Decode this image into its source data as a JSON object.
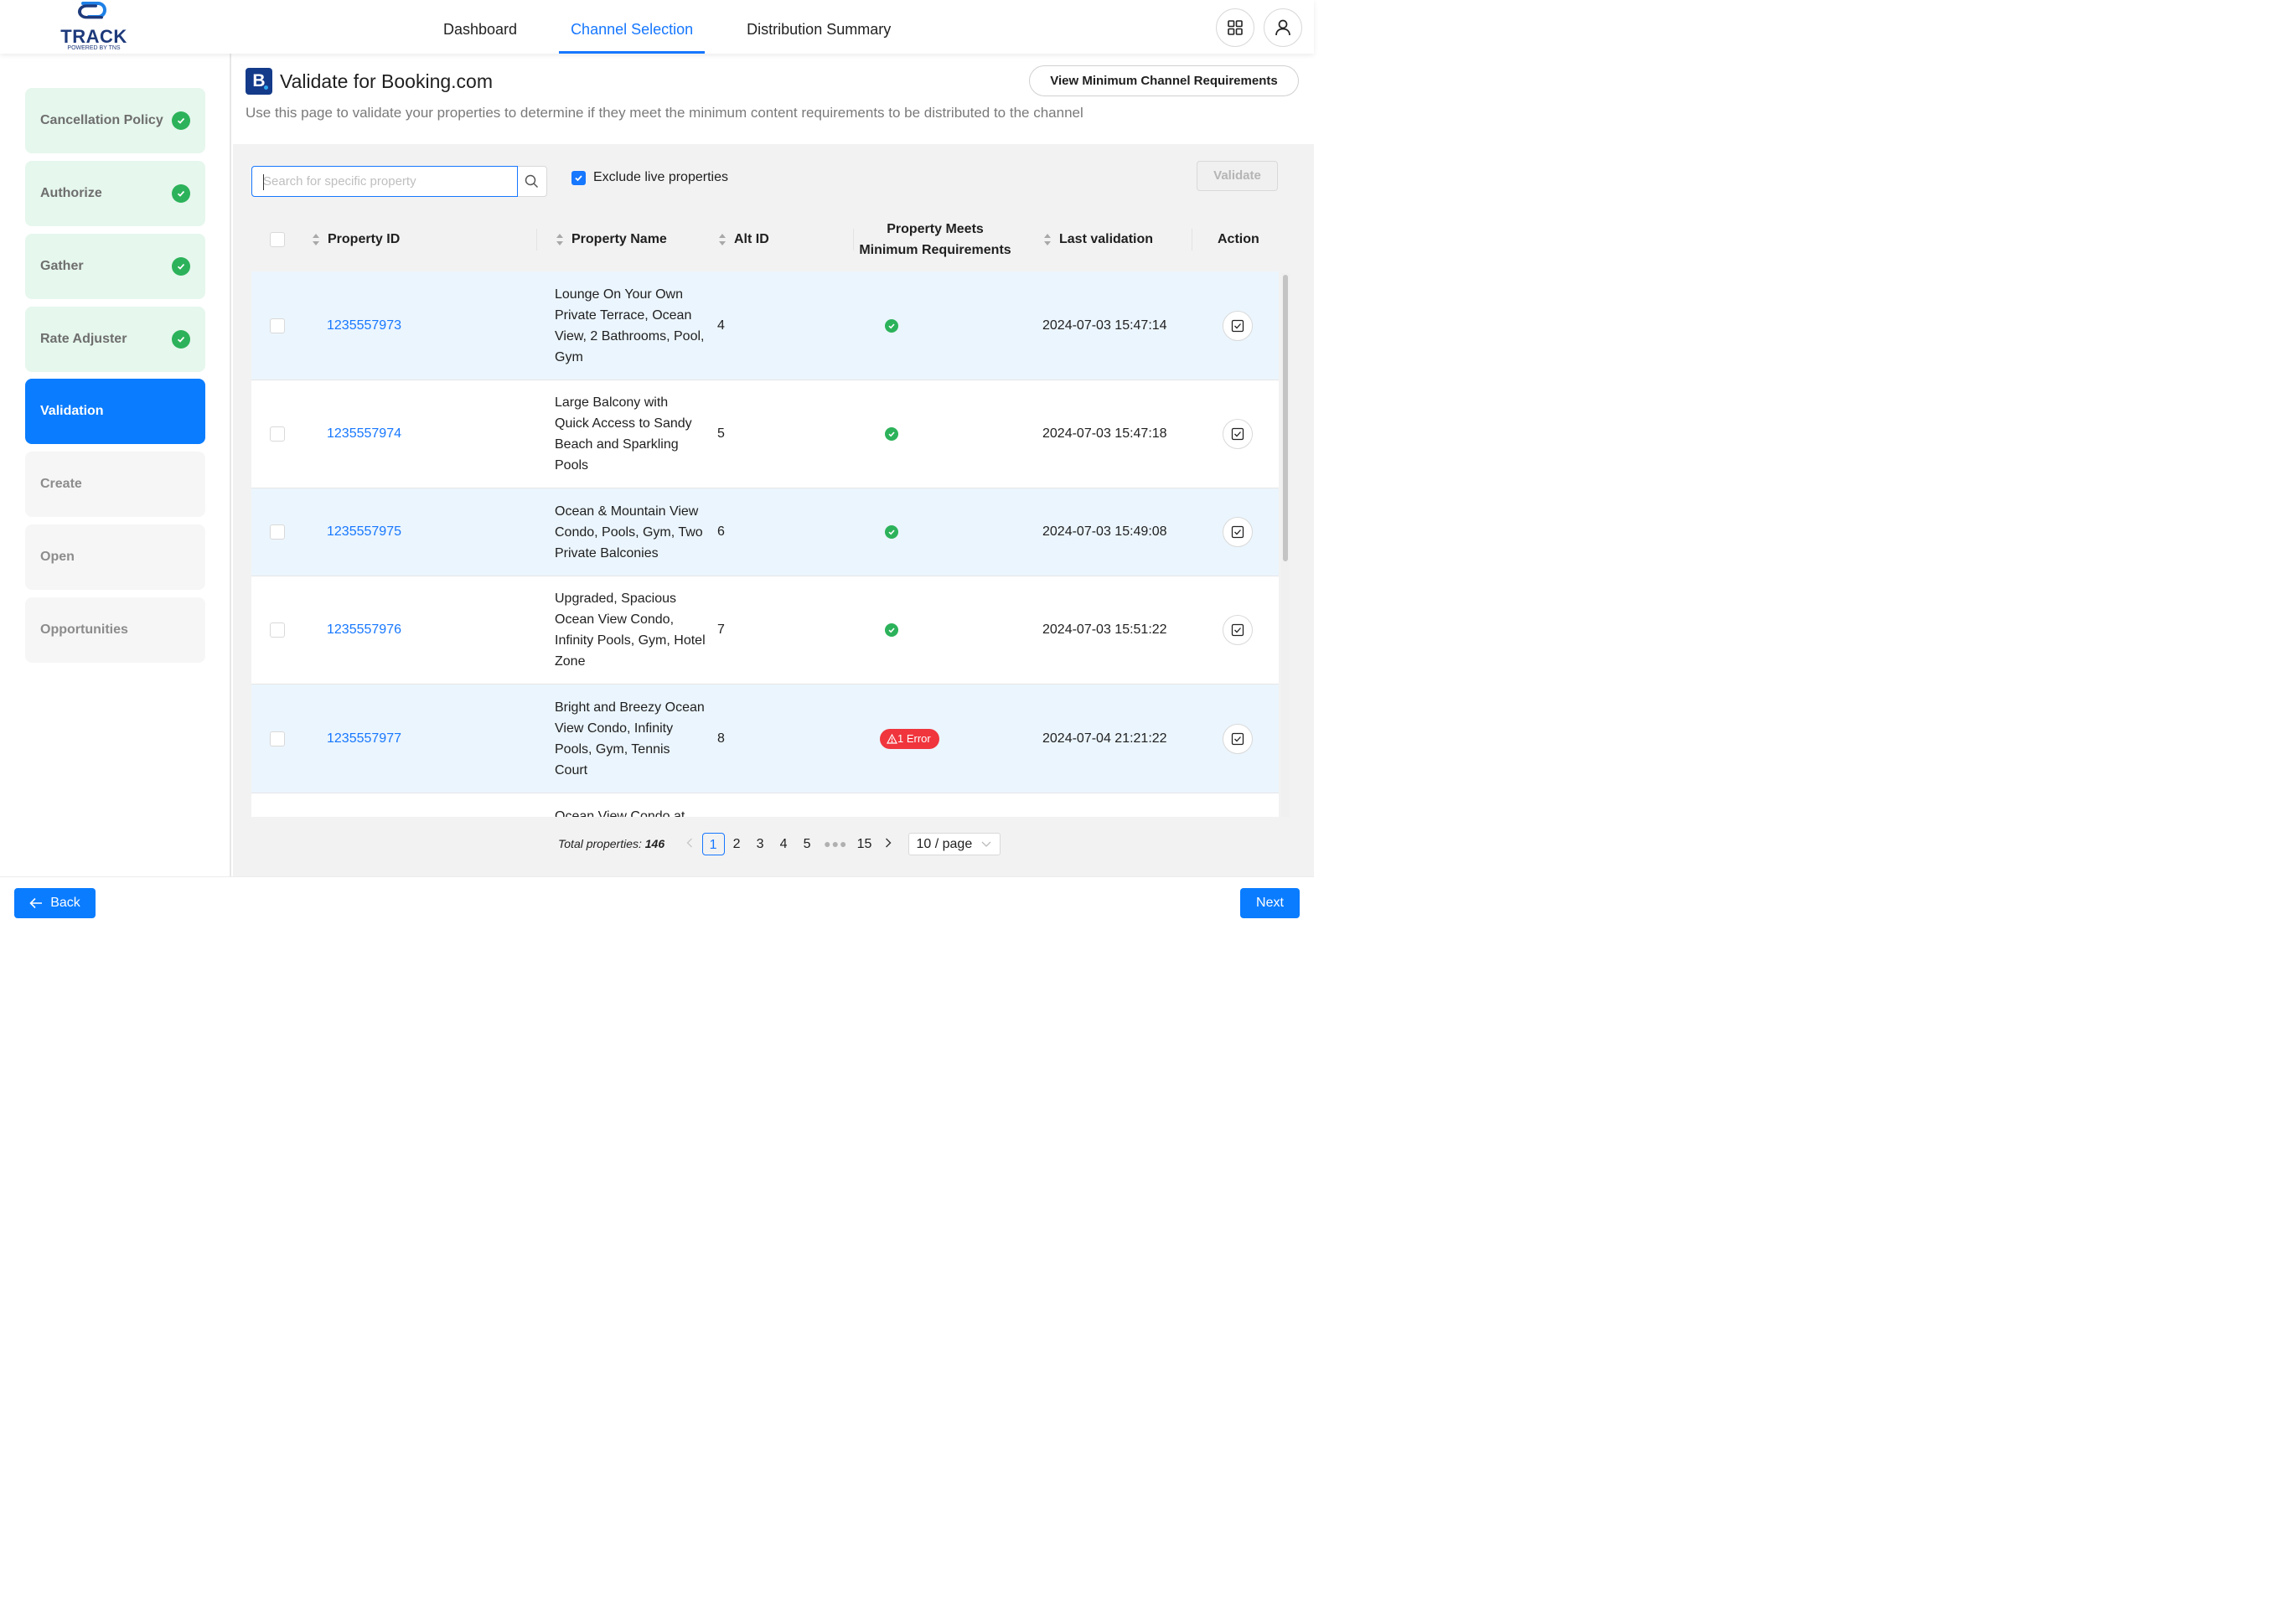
{
  "app": {
    "logo_text": "TRACK",
    "logo_sub": "POWERED BY TNS"
  },
  "nav": {
    "tabs": [
      {
        "label": "Dashboard"
      },
      {
        "label": "Channel Selection"
      },
      {
        "label": "Distribution Summary"
      }
    ]
  },
  "header": {
    "apps_icon": "grid-icon",
    "user_icon": "user-icon"
  },
  "sidebar": {
    "steps": [
      {
        "label": "Cancellation Policy",
        "status": "done"
      },
      {
        "label": "Authorize",
        "status": "done"
      },
      {
        "label": "Gather",
        "status": "done"
      },
      {
        "label": "Rate Adjuster",
        "status": "done"
      },
      {
        "label": "Validation",
        "status": "current"
      },
      {
        "label": "Create",
        "status": "todo"
      },
      {
        "label": "Open",
        "status": "todo"
      },
      {
        "label": "Opportunities",
        "status": "todo"
      }
    ]
  },
  "page": {
    "channel_logo": "B",
    "title": "Validate for Booking.com",
    "description": "Use this page to validate your properties to determine if they meet the minimum content requirements to be distributed to the channel",
    "requirements_button": "View Minimum Channel Requirements"
  },
  "toolbar": {
    "search_placeholder": "Search for specific property",
    "exclude_label": "Exclude live properties",
    "exclude_checked": true,
    "validate_label": "Validate"
  },
  "table": {
    "headers": {
      "property_id": "Property ID",
      "property_name": "Property Name",
      "alt_id": "Alt ID",
      "meets_line1": "Property Meets",
      "meets_line2": "Minimum Requirements",
      "last_validation": "Last validation",
      "action": "Action"
    },
    "rows": [
      {
        "id": "1235557973",
        "name": "Lounge On Your Own Private Terrace, Ocean View, 2 Bathrooms, Pool, Gym",
        "alt": "4",
        "status": "ok",
        "status_text": "",
        "last": "2024-07-03 15:47:14"
      },
      {
        "id": "1235557974",
        "name": "Large Balcony with Quick Access to Sandy Beach and Sparkling Pools",
        "alt": "5",
        "status": "ok",
        "status_text": "",
        "last": "2024-07-03 15:47:18"
      },
      {
        "id": "1235557975",
        "name": "Ocean & Mountain View Condo, Pools, Gym, Two Private Balconies",
        "alt": "6",
        "status": "ok",
        "status_text": "",
        "last": "2024-07-03 15:49:08"
      },
      {
        "id": "1235557976",
        "name": "Upgraded, Spacious Ocean View Condo, Infinity Pools, Gym, Hotel Zone",
        "alt": "7",
        "status": "ok",
        "status_text": "",
        "last": "2024-07-03 15:51:22"
      },
      {
        "id": "1235557977",
        "name": "Bright and Breezy Ocean View Condo, Infinity Pools, Gym, Tennis Court",
        "alt": "8",
        "status": "error",
        "status_text": "1 Error",
        "last": "2024-07-04 21:21:22"
      },
      {
        "id": "",
        "name": "Ocean View Condo at",
        "alt": "",
        "status": "",
        "status_text": "",
        "last": ""
      }
    ]
  },
  "pagination": {
    "total_label": "Total properties:",
    "total": "146",
    "pages": [
      "1",
      "2",
      "3",
      "4",
      "5"
    ],
    "current": "1",
    "last_page": "15",
    "page_size": "10 / page"
  },
  "footer": {
    "back_label": "Back",
    "next_label": "Next"
  },
  "colors": {
    "primary": "#0a7cff",
    "success": "#2cb25a",
    "error": "#f0353d",
    "done_bg": "#e6f7ed",
    "row_alt": "#ebf5fd"
  }
}
